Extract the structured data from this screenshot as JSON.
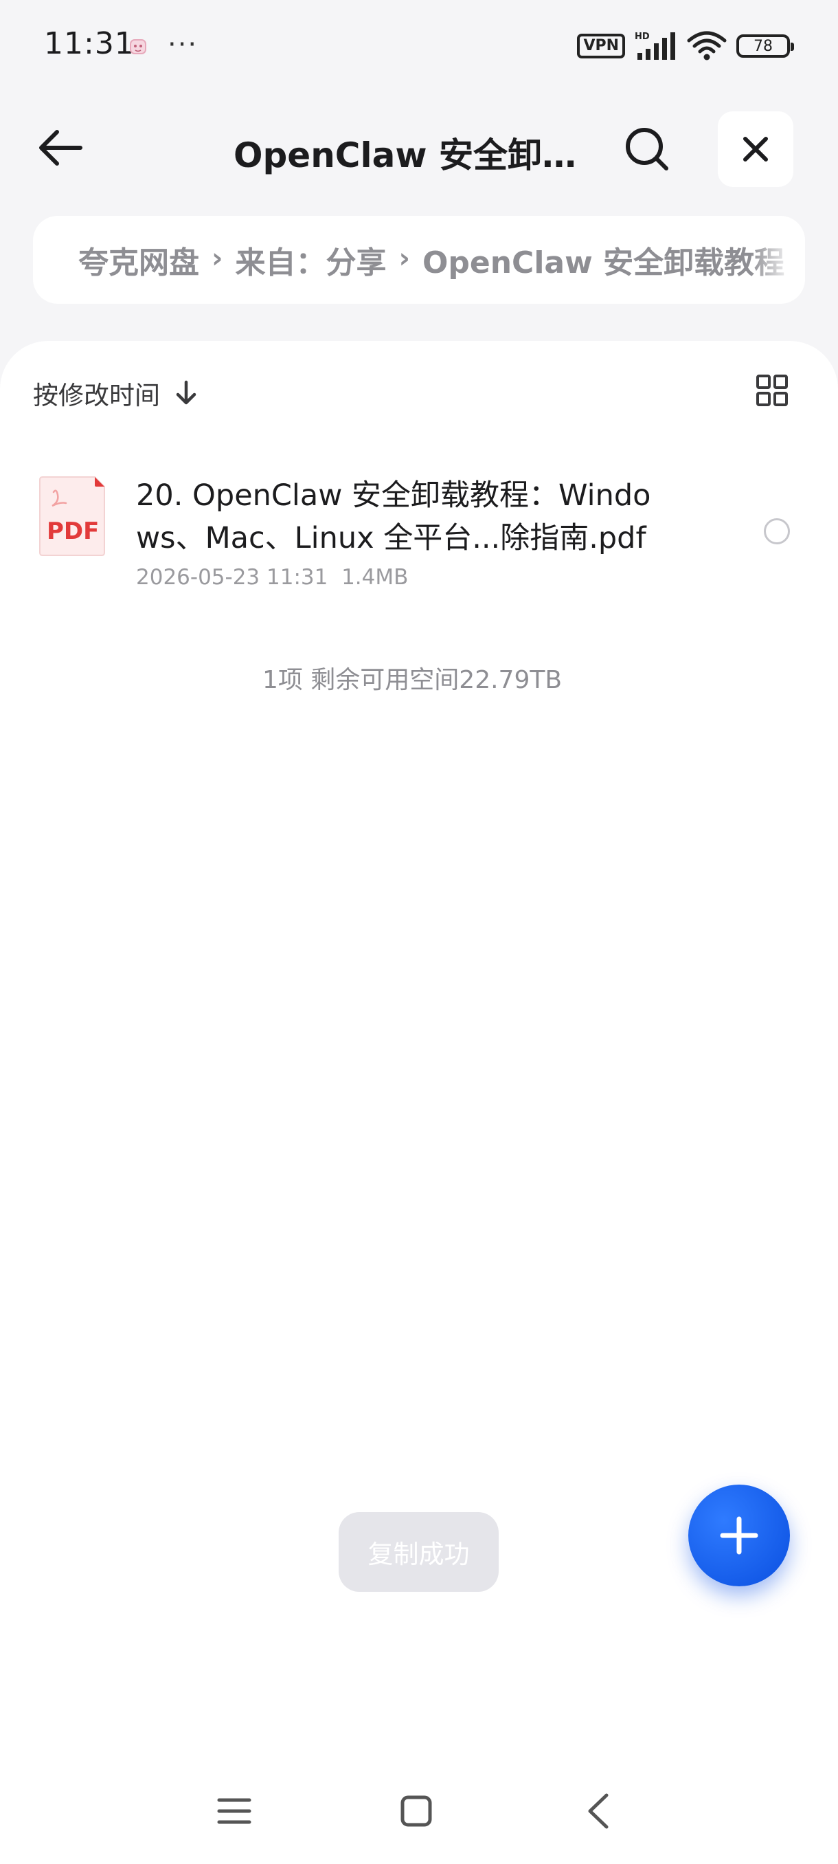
{
  "status_bar": {
    "time": "11:31",
    "more": "···",
    "vpn": "VPN",
    "battery": "78"
  },
  "header": {
    "title": "OpenClaw 安全卸…"
  },
  "breadcrumb": {
    "items": [
      "夸克网盘",
      "来自：分享",
      "OpenClaw 安全卸载教程"
    ]
  },
  "toolbar": {
    "sort_label": "按修改时间"
  },
  "files": [
    {
      "name": "20. OpenClaw 安全卸载教程：Windows、Mac、Linux 全平台...除指南.pdf",
      "date": "2026-05-23 11:31",
      "size": "1.4MB",
      "icon_label": "PDF"
    }
  ],
  "summary": "1项 剩余可用空间22.79TB",
  "toast": "复制成功",
  "colors": {
    "accent": "#1a5cf0",
    "pdf_red": "#e23a3a",
    "muted": "#8e8e93"
  }
}
